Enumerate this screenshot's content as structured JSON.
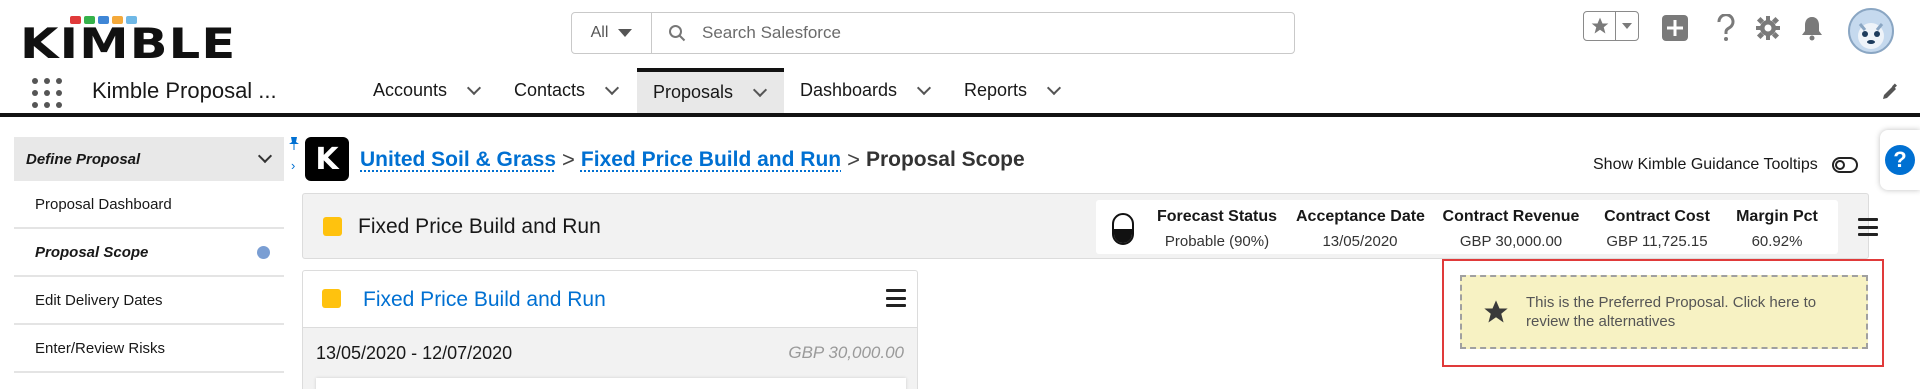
{
  "brand": {
    "logo_text": "KIMBLE",
    "dot_colors": [
      "#e03a3a",
      "#35b24a",
      "#3f86d6",
      "#f4a93a",
      "#6fb8e6"
    ]
  },
  "search": {
    "scope": "All",
    "placeholder": "Search Salesforce"
  },
  "header_icons": [
    "favorites-star-icon",
    "favorites-caret-icon",
    "global-add-icon",
    "help-icon",
    "setup-gear-icon",
    "notifications-bell-icon",
    "avatar"
  ],
  "nav": {
    "app_name": "Kimble Proposal ...",
    "tabs": [
      {
        "label": "Accounts",
        "active": false
      },
      {
        "label": "Contacts",
        "active": false
      },
      {
        "label": "Proposals",
        "active": true
      },
      {
        "label": "Dashboards",
        "active": false
      },
      {
        "label": "Reports",
        "active": false
      }
    ]
  },
  "sidebar": {
    "header": "Define Proposal",
    "items": [
      {
        "label": "Proposal Dashboard",
        "active": false
      },
      {
        "label": "Proposal Scope",
        "active": true
      },
      {
        "label": "Edit Delivery Dates",
        "active": false
      },
      {
        "label": "Enter/Review Risks",
        "active": false
      }
    ]
  },
  "breadcrumb": {
    "badge": "K",
    "links": [
      "United Soil & Grass",
      "Fixed Price Build and Run"
    ],
    "separator": ">",
    "current": "Proposal Scope"
  },
  "guidance_toggle": {
    "label": "Show Kimble Guidance Tooltips",
    "on": false
  },
  "proposal": {
    "title": "Fixed Price Build and Run",
    "status_color": "#ffc20e",
    "forecast_level": 0.9,
    "stats": [
      {
        "label": "Forecast Status",
        "value": "Probable (90%)"
      },
      {
        "label": "Acceptance Date",
        "value": "13/05/2020"
      },
      {
        "label": "Contract Revenue",
        "value": "GBP 30,000.00"
      },
      {
        "label": "Contract Cost",
        "value": "GBP 11,725.15"
      },
      {
        "label": "Margin Pct",
        "value": "60.92%"
      }
    ]
  },
  "card": {
    "title": "Fixed Price Build and Run",
    "dates": "13/05/2020 - 12/07/2020",
    "amount": "GBP 30,000.00"
  },
  "preferred_notice": {
    "text": "This is the Preferred Proposal. Click here to review the alternatives"
  },
  "colors": {
    "link": "#0070d2",
    "accent_yellow": "#ffc20e",
    "notice_bg": "#f7f2c3",
    "highlight_border": "#e03a3a"
  }
}
